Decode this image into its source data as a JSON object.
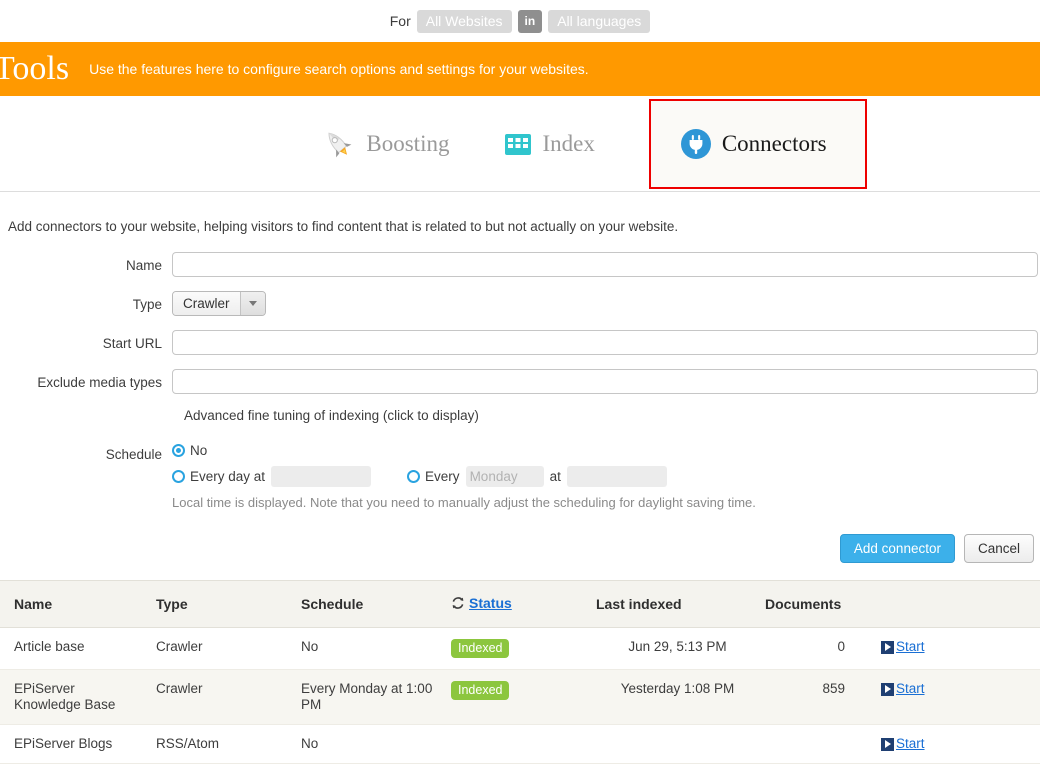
{
  "scope": {
    "for_label": "For",
    "website_pill": "All Websites",
    "in_label": "in",
    "language_pill": "All languages"
  },
  "banner": {
    "title": "Tools",
    "subtitle": "Use the features here to configure search options and settings for your websites.",
    "color": "#ff9900"
  },
  "tabs": [
    {
      "label": "Boosting",
      "icon": "rocket-icon",
      "active": false
    },
    {
      "label": "Index",
      "icon": "grid-icon",
      "active": false
    },
    {
      "label": "Connectors",
      "icon": "plug-icon",
      "active": true
    }
  ],
  "highlight_color": "#ee0000",
  "main": {
    "intro": "Add connectors to your website, helping visitors to find content that is related to but not actually on your website.",
    "fields": {
      "name_label": "Name",
      "name_value": "",
      "type_label": "Type",
      "type_value": "Crawler",
      "start_url_label": "Start URL",
      "start_url_value": "",
      "exclude_label": "Exclude media types",
      "exclude_value": ""
    },
    "advanced_link": "Advanced fine tuning of indexing (click to display)",
    "schedule": {
      "label": "Schedule",
      "option_no": "No",
      "option_every_day": "Every day at",
      "every_day_time": "",
      "option_every": "Every",
      "every_day_name": "Monday",
      "at_label": "at",
      "every_week_time": "",
      "selected": "No",
      "note": "Local time is displayed. Note that you need to manually adjust the scheduling for daylight saving time."
    },
    "buttons": {
      "submit": "Add connector",
      "cancel": "Cancel",
      "submit_color": "#3cb0ea"
    }
  },
  "table": {
    "headers": {
      "name": "Name",
      "type": "Type",
      "schedule": "Schedule",
      "status": "Status",
      "last_indexed": "Last indexed",
      "documents": "Documents",
      "actions": ""
    },
    "status_icon": "refresh-icon",
    "rows": [
      {
        "name": "Article base",
        "type": "Crawler",
        "schedule": "No",
        "status": "Indexed",
        "last_indexed": "Jun 29, 5:13 PM",
        "documents": "0",
        "action": "Start"
      },
      {
        "name": "EPiServer Knowledge Base",
        "type": "Crawler",
        "schedule": "Every Monday at 1:00 PM",
        "status": "Indexed",
        "last_indexed": "Yesterday 1:08 PM",
        "documents": "859",
        "action": "Start"
      },
      {
        "name": "EPiServer Blogs",
        "type": "RSS/Atom",
        "schedule": "No",
        "status": "",
        "last_indexed": "",
        "documents": "",
        "action": "Start"
      }
    ],
    "status_badge_color": "#8cc63e"
  }
}
